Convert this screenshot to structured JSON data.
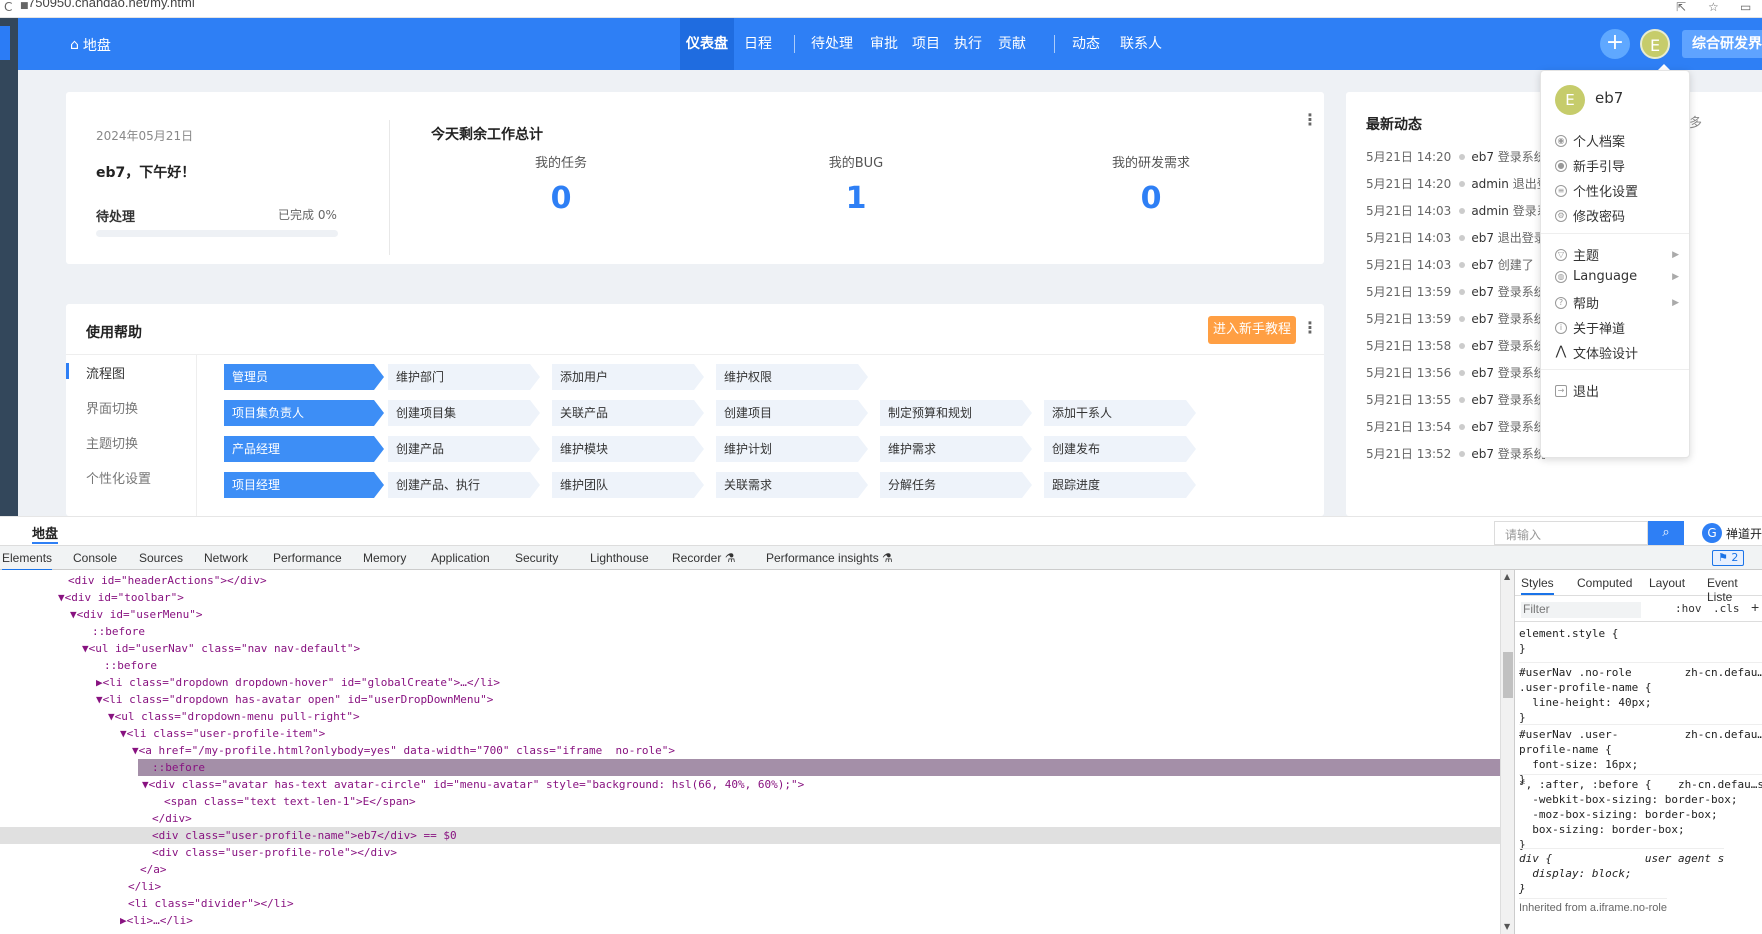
{
  "browser": {
    "url": "750950.chandao.net/my.html"
  },
  "topnav": {
    "home": "地盘",
    "items": [
      "仪表盘",
      "日程",
      "待处理",
      "审批",
      "项目",
      "执行",
      "贡献",
      "动态",
      "联系人"
    ],
    "avatar_letter": "E",
    "workspace": "综合研发界面"
  },
  "welcome": {
    "date": "2024年05月21日",
    "greeting": "eb7，下午好！",
    "pending_label": "待处理",
    "done_label": "已完成 0%",
    "progress": 0
  },
  "work": {
    "title": "今天剩余工作总计",
    "stats": [
      {
        "label": "我的任务",
        "value": "0"
      },
      {
        "label": "我的BUG",
        "value": "1"
      },
      {
        "label": "我的研发需求",
        "value": "0"
      }
    ]
  },
  "help": {
    "title": "使用帮助",
    "guide_button": "进入新手教程",
    "side": [
      "流程图",
      "界面切换",
      "主题切换",
      "个性化设置"
    ],
    "rows": [
      {
        "role": "管理员",
        "steps": [
          "维护部门",
          "添加用户",
          "维护权限"
        ]
      },
      {
        "role": "项目集负责人",
        "steps": [
          "创建项目集",
          "关联产品",
          "创建项目",
          "制定预算和规划",
          "添加干系人"
        ]
      },
      {
        "role": "产品经理",
        "steps": [
          "创建产品",
          "维护模块",
          "维护计划",
          "维护需求",
          "创建发布"
        ]
      },
      {
        "role": "项目经理",
        "steps": [
          "创建产品、执行",
          "维护团队",
          "关联需求",
          "分解任务",
          "跟踪进度"
        ]
      }
    ]
  },
  "feed": {
    "title": "最新动态",
    "more": "更多",
    "items": [
      {
        "time": "5月21日 14:20",
        "user": "eb7",
        "action": "登录系统"
      },
      {
        "time": "5月21日 14:20",
        "user": "admin",
        "action": "退出登录"
      },
      {
        "time": "5月21日 14:03",
        "user": "admin",
        "action": "登录系统"
      },
      {
        "time": "5月21日 14:03",
        "user": "eb7",
        "action": "退出登录"
      },
      {
        "time": "5月21日 14:03",
        "user": "eb7",
        "action": "创建了"
      },
      {
        "time": "5月21日 13:59",
        "user": "eb7",
        "action": "登录系统"
      },
      {
        "time": "5月21日 13:59",
        "user": "eb7",
        "action": "登录系统"
      },
      {
        "time": "5月21日 13:58",
        "user": "eb7",
        "action": "登录系统"
      },
      {
        "time": "5月21日 13:56",
        "user": "eb7",
        "action": "登录系统"
      },
      {
        "time": "5月21日 13:55",
        "user": "eb7",
        "action": "登录系统"
      },
      {
        "time": "5月21日 13:54",
        "user": "eb7",
        "action": "登录系统"
      },
      {
        "time": "5月21日 13:52",
        "user": "eb7",
        "action": "登录系统"
      }
    ]
  },
  "user_menu": {
    "avatar_letter": "E",
    "name": "eb7",
    "items": [
      "个人档案",
      "新手引导",
      "个性化设置",
      "修改密码"
    ],
    "items2": [
      "主题",
      "Language",
      "帮助",
      "关于禅道",
      "文体验设计"
    ],
    "logout": "退出"
  },
  "footer": {
    "brand": "地盘",
    "search_placeholder": "请输入",
    "logo_text": "禅道开"
  },
  "devtools": {
    "tabs": [
      "Elements",
      "Console",
      "Sources",
      "Network",
      "Performance",
      "Memory",
      "Application",
      "Security",
      "Lighthouse",
      "Recorder ⚗",
      "Performance insights ⚗"
    ],
    "issues_badge": "2",
    "styles_tabs": [
      "Styles",
      "Computed",
      "Layout",
      "Event Liste"
    ],
    "filter_placeholder": "Filter",
    "filter_hov": ":hov",
    "filter_cls": ".cls",
    "dom_lines": [
      "<div id=\"headerActions\"></div>",
      "▼<div id=\"toolbar\">",
      "▼<div id=\"userMenu\">",
      "::before",
      "▼<ul id=\"userNav\" class=\"nav nav-default\">",
      "::before",
      "▶<li class=\"dropdown dropdown-hover\" id=\"globalCreate\">…</li>",
      "▼<li class=\"dropdown has-avatar open\" id=\"userDropDownMenu\">",
      "▼<ul class=\"dropdown-menu pull-right\">",
      "▼<li class=\"user-profile-item\">",
      "▼<a href=\"/my-profile.html?onlybody=yes\" data-width=\"700\" class=\"iframe  no-role\">",
      "::before",
      "▼<div class=\"avatar has-text avatar-circle\" id=\"menu-avatar\" style=\"background: hsl(66, 40%, 60%);\">",
      "<span class=\"text text-len-1\">E</span>",
      "</div>",
      "<div class=\"user-profile-name\">eb7</div> == $0",
      "<div class=\"user-profile-role\"></div>",
      "</a>",
      "</li>",
      "<li class=\"divider\"></li>",
      "▶<li>…</li>"
    ],
    "styles_rules": [
      "element.style {\n}",
      "#userNav .no-role        zh-cn.defau…s?\n.user-profile-name {\n  line-height: 40px;\n}",
      "#userNav .user-          zh-cn.defau…s?\nprofile-name {\n  font-size: 16px;\n}",
      "*, :after, :before {    zh-cn.defau…s\n  -webkit-box-sizing: border-box;\n  -moz-box-sizing: border-box;\n  box-sizing: border-box;\n}",
      "div {              user agent s\n  display: block;\n}",
      "Inherited from a.iframe.no-role"
    ]
  }
}
